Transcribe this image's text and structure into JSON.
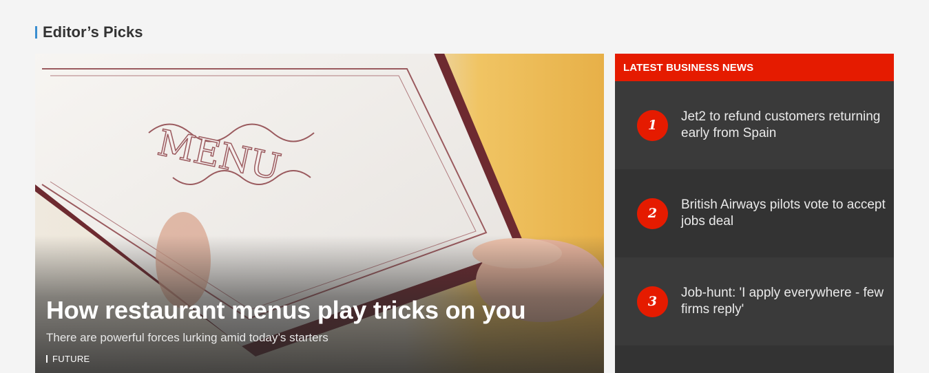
{
  "section": {
    "title": "Editor’s Picks"
  },
  "hero": {
    "headline": "How restaurant menus play tricks on you",
    "summary": "There are powerful forces lurking amid today’s starters",
    "tag": "FUTURE",
    "image_text": "MENU"
  },
  "news": {
    "heading": "LATEST BUSINESS NEWS",
    "items": [
      {
        "rank": "1",
        "title": "Jet2 to refund customers returning early from Spain"
      },
      {
        "rank": "2",
        "title": "British Airways pilots vote to accept jobs deal"
      },
      {
        "rank": "3",
        "title": "Job-hunt: 'I apply everywhere - few firms reply'"
      }
    ]
  },
  "colors": {
    "accent_blue": "#3a8ed0",
    "news_red": "#e51b00",
    "panel_dark": "#3a3a3a"
  }
}
